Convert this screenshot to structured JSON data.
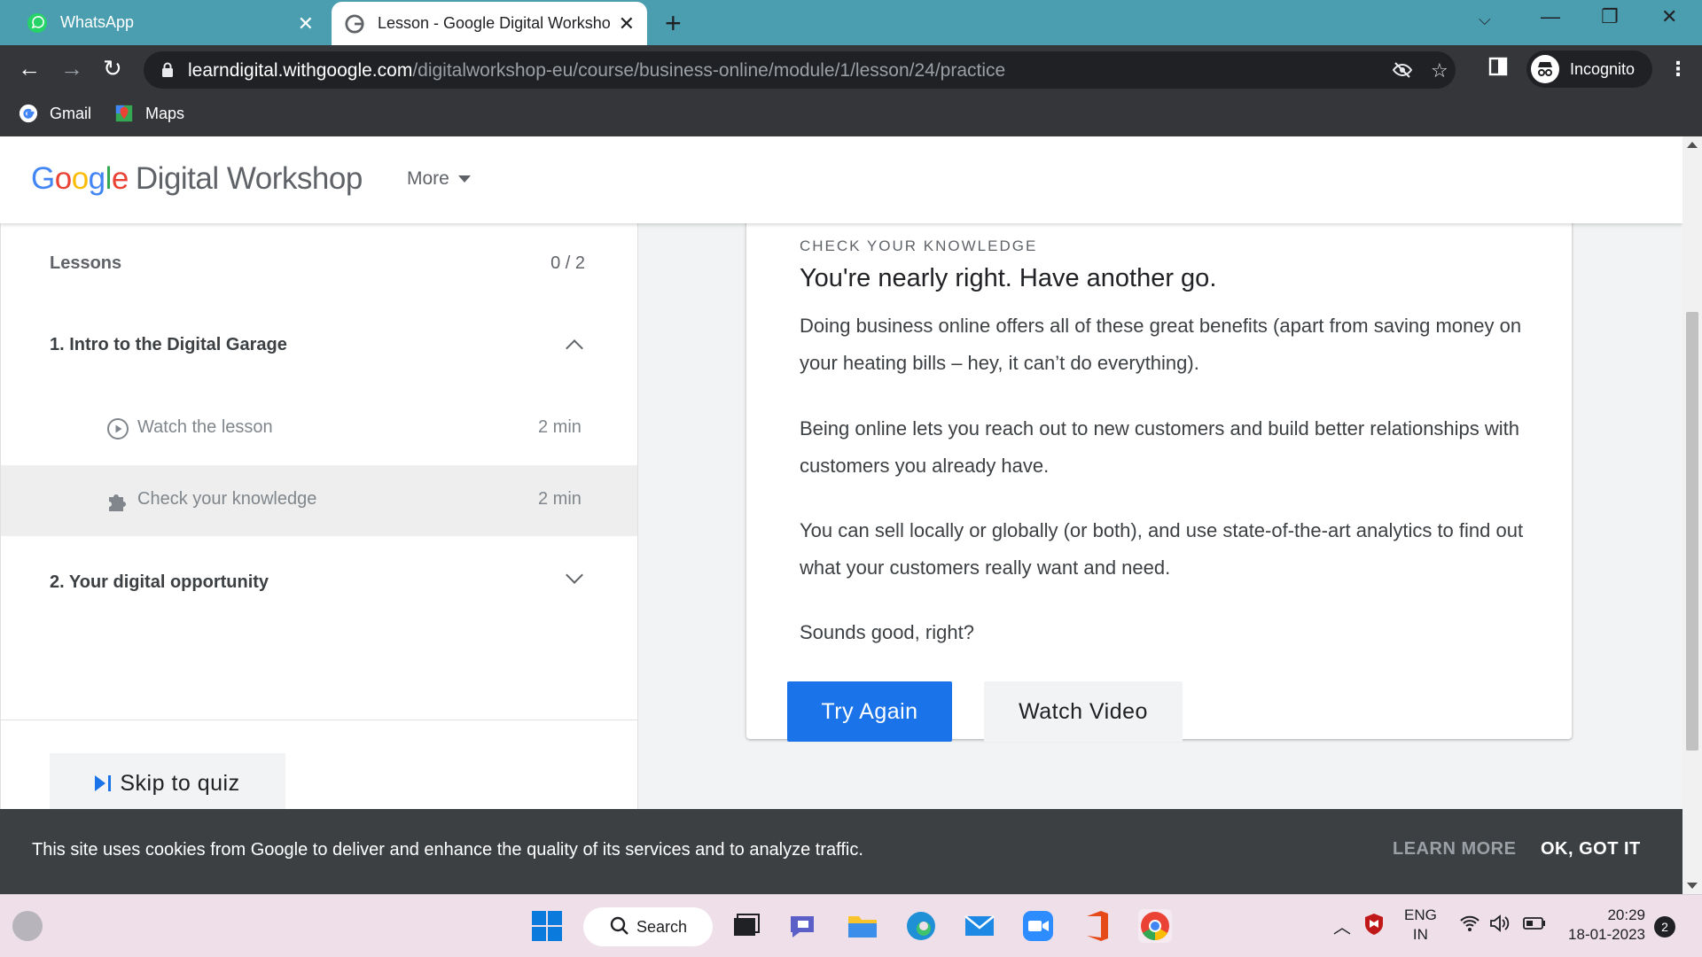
{
  "browser": {
    "tabs": [
      {
        "title": "WhatsApp",
        "icon": "whatsapp-icon"
      },
      {
        "title": "Lesson - Google Digital Worksho",
        "icon": "google-icon"
      }
    ],
    "url_host": "learndigital.withgoogle.com",
    "url_path": "/digitalworkshop-eu/course/business-online/module/1/lesson/24/practice",
    "profile_label": "Incognito",
    "bookmarks": [
      {
        "label": "Gmail",
        "icon": "google-icon"
      },
      {
        "label": "Maps",
        "icon": "maps-icon"
      }
    ]
  },
  "site": {
    "logo_google": "Google",
    "logo_product": "Digital Workshop",
    "more_label": "More"
  },
  "sidebar": {
    "lessons_label": "Lessons",
    "lessons_count": "0 / 2",
    "modules": [
      {
        "title": "1. Intro to the Digital Garage",
        "expanded": true
      },
      {
        "title": "2. Your digital opportunity",
        "expanded": false
      }
    ],
    "items": [
      {
        "label": "Watch the lesson",
        "duration": "2 min",
        "icon": "play-circle-icon"
      },
      {
        "label": "Check your knowledge",
        "duration": "2 min",
        "icon": "puzzle-icon"
      }
    ],
    "skip_label": "Skip to quiz"
  },
  "quiz": {
    "eyebrow": "CHECK YOUR KNOWLEDGE",
    "heading": "You're nearly right. Have another go.",
    "paragraphs": [
      "Doing business online offers all of these great benefits (apart from saving money on your heating bills – hey, it can’t do everything).",
      "Being online lets you reach out to new customers and build better relationships with customers you already have.",
      "You can sell locally or globally (or both), and use state-of-the-art analytics to find out what your customers really want and need.",
      "Sounds good, right?"
    ],
    "try_again": "Try Again",
    "watch_video": "Watch Video"
  },
  "cookie": {
    "text": "This site uses cookies from Google to deliver and enhance the quality of its services and to analyze traffic.",
    "learn_more": "LEARN MORE",
    "ok": "OK, GOT IT"
  },
  "taskbar": {
    "search_label": "Search",
    "lang_top": "ENG",
    "lang_bottom": "IN",
    "time": "20:29",
    "date": "18-01-2023",
    "notification_count": "2"
  },
  "colors": {
    "tabbar": "#4a9eaf",
    "accent": "#1a73e8",
    "cookie_bar": "#3c4043"
  }
}
